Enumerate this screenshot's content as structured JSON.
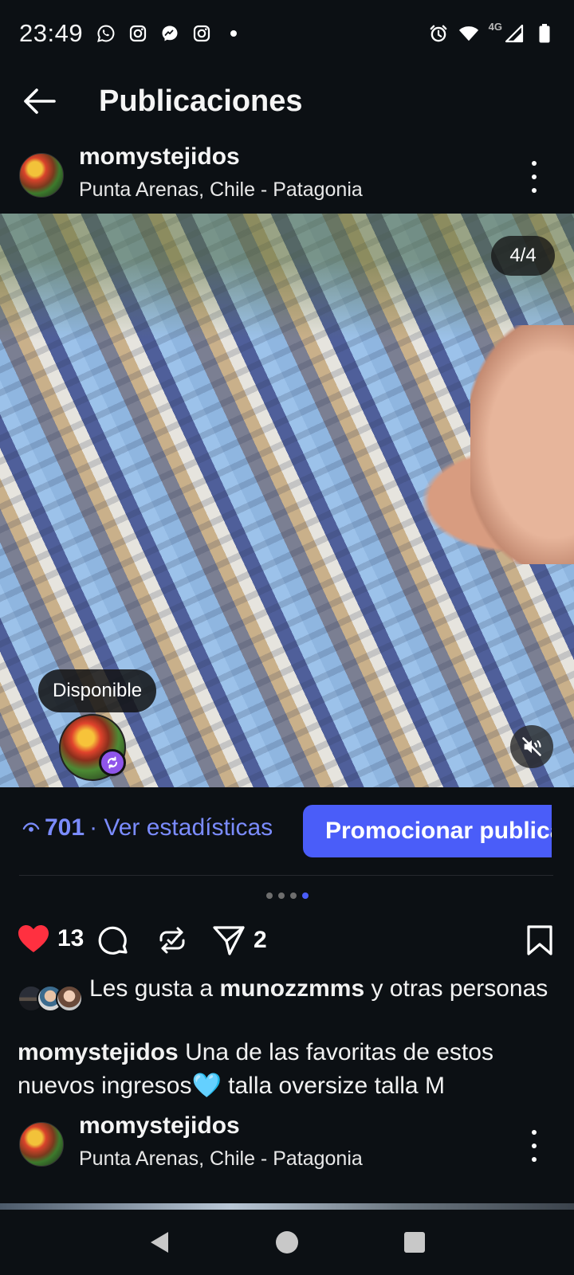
{
  "status_bar": {
    "time": "23:49",
    "network_label": "4G",
    "notification_icons": [
      "whatsapp-icon",
      "instagram-icon",
      "messenger-icon",
      "instagram-icon"
    ],
    "system_icons": [
      "alarm-icon",
      "wifi-icon",
      "signal-icon",
      "battery-icon"
    ]
  },
  "header": {
    "title": "Publicaciones"
  },
  "posts": [
    {
      "username": "momystejidos",
      "location": "Punta Arenas, Chile - Patagonia",
      "image_counter": "4/4",
      "tag_label": "Disponible",
      "views_count": "701",
      "views_link": "· Ver estadísticas",
      "promote_label": "Promocionar publicación",
      "carousel": {
        "total": 4,
        "active": 4
      },
      "likes_count": "13",
      "shares_count": "2",
      "likes_prefix": "Les gusta a ",
      "likes_user": "munozzmms",
      "likes_suffix": " y otras personas",
      "caption_user": "momystejidos",
      "caption_text": " Una de las favoritas de estos nuevos ingresos🩵 talla oversize talla M"
    },
    {
      "username": "momystejidos",
      "location": "Punta Arenas, Chile - Patagonia"
    }
  ],
  "colors": {
    "background": "#0c1014",
    "accent": "#4a5df9",
    "link": "#7b8cff",
    "heart": "#ff3040"
  }
}
